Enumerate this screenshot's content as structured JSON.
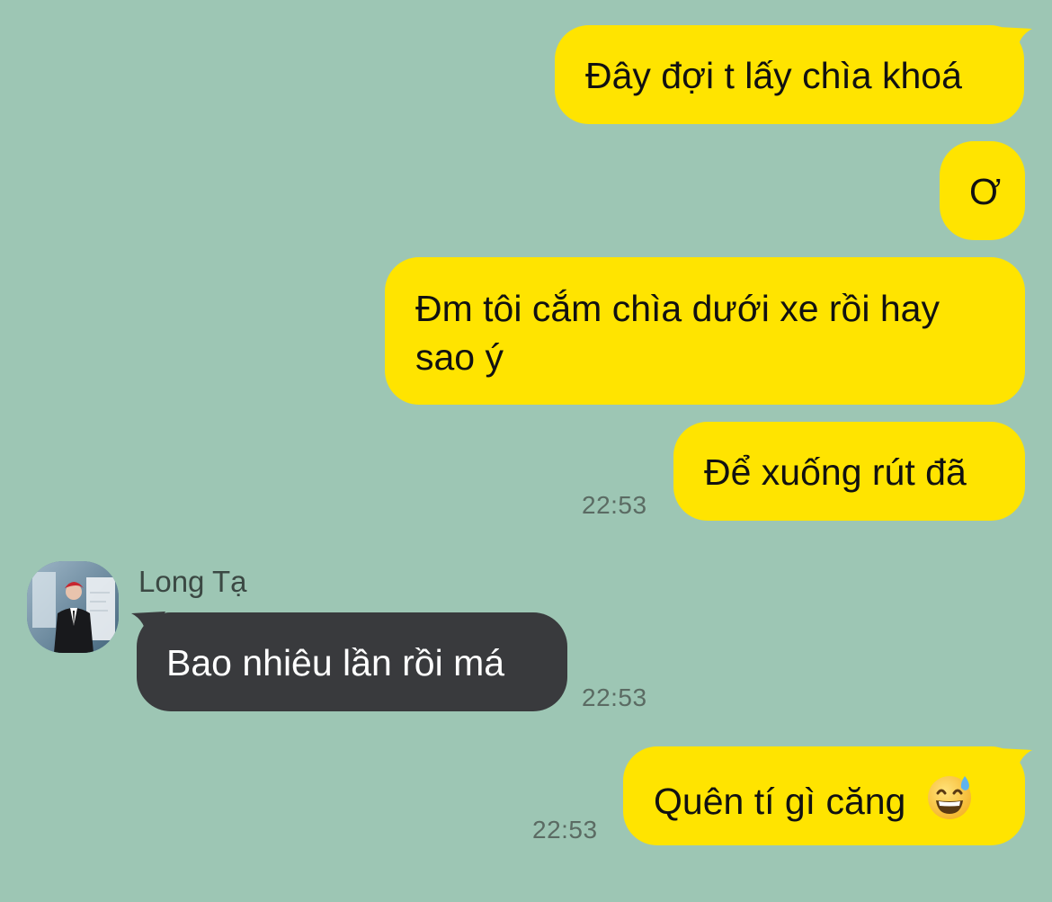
{
  "contact": {
    "name": "Long Tạ",
    "avatar": "avatar-photo"
  },
  "messages": [
    {
      "direction": "out",
      "text": "Đây đợi t lấy chìa khoá"
    },
    {
      "direction": "out",
      "text": "Ơ"
    },
    {
      "direction": "out",
      "text": "Đm tôi cắm chìa dưới xe rồi hay sao ý"
    },
    {
      "direction": "out",
      "text": "Để xuống rút đã",
      "time": "22:53"
    },
    {
      "direction": "in",
      "text": "Bao nhiêu lần rồi má",
      "time": "22:53"
    },
    {
      "direction": "out",
      "text": "Quên tí gì căng",
      "emoji": "grinning-face-with-sweat-icon",
      "time": "22:53"
    }
  ],
  "colors": {
    "background": "#9dc6b4",
    "outgoing_bubble": "#ffe400",
    "incoming_bubble": "#393a3d"
  }
}
